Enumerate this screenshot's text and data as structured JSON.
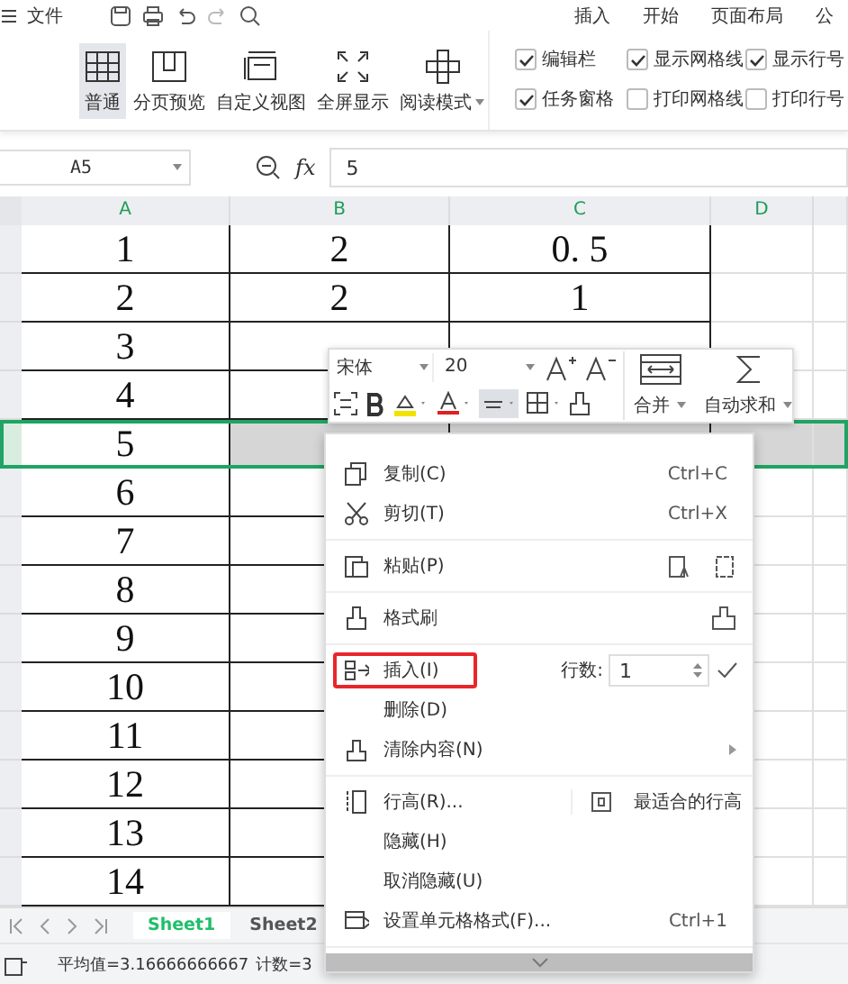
{
  "menu_bar": {
    "file_menu": "文件",
    "tabs": [
      {
        "label": "插入",
        "selected": false
      },
      {
        "label": "开始",
        "selected": false
      },
      {
        "label": "页面布局",
        "selected": false
      },
      {
        "label": "公",
        "selected": false
      }
    ]
  },
  "view_buttons": [
    {
      "label": "普通",
      "selected": true,
      "dropdown": false
    },
    {
      "label": "分页预览",
      "selected": false,
      "dropdown": false
    },
    {
      "label": "自定义视图",
      "selected": false,
      "dropdown": false
    },
    {
      "label": "全屏显示",
      "selected": false,
      "dropdown": false
    },
    {
      "label": "阅读模式",
      "selected": false,
      "dropdown": true
    }
  ],
  "view_options": [
    {
      "label": "编辑栏",
      "checked": true
    },
    {
      "label": "显示网格线",
      "checked": true
    },
    {
      "label": "显示行号",
      "checked": true
    },
    {
      "label": "任务窗格",
      "checked": true
    },
    {
      "label": "打印网格线",
      "checked": false
    },
    {
      "label": "打印行号",
      "checked": false
    }
  ],
  "formula_bar": {
    "name_box": "A5",
    "fx": "fx",
    "value": "5"
  },
  "sheet": {
    "columns": [
      "A",
      "B",
      "C",
      "D"
    ],
    "rows": [
      {
        "cells": [
          "1",
          "2",
          "0. 5"
        ],
        "selected": false
      },
      {
        "cells": [
          "2",
          "2",
          "1"
        ],
        "selected": false
      },
      {
        "cells": [
          "3"
        ],
        "selected": false
      },
      {
        "cells": [
          "4"
        ],
        "selected": false
      },
      {
        "cells": [
          "5"
        ],
        "selected": true
      },
      {
        "cells": [
          "6"
        ],
        "selected": false
      },
      {
        "cells": [
          "7"
        ],
        "selected": false
      },
      {
        "cells": [
          "8"
        ],
        "selected": false
      },
      {
        "cells": [
          "9"
        ],
        "selected": false
      },
      {
        "cells": [
          "10"
        ],
        "selected": false
      },
      {
        "cells": [
          "11"
        ],
        "selected": false
      },
      {
        "cells": [
          "12"
        ],
        "selected": false
      },
      {
        "cells": [
          "13"
        ],
        "selected": false
      },
      {
        "cells": [
          "14"
        ],
        "selected": false
      }
    ]
  },
  "mini_toolbar": {
    "font": "宋体",
    "size": "20",
    "merge": "合并",
    "autosum": "自动求和"
  },
  "context_menu": {
    "items": [
      {
        "label": "复制(C)",
        "shortcut": "Ctrl+C",
        "highlighted": false
      },
      {
        "label": "剪切(T)",
        "shortcut": "Ctrl+X",
        "highlighted": false,
        "divider_after": true
      },
      {
        "label": "粘贴(P)",
        "highlighted": false,
        "divider_after": true
      },
      {
        "label": "格式刷",
        "highlighted": false,
        "divider_after": true
      },
      {
        "label": "插入(I)",
        "highlighted": true,
        "rows_label": "行数:",
        "rows_value": "1"
      },
      {
        "label": "删除(D)",
        "highlighted": false
      },
      {
        "label": "清除内容(N)",
        "submenu": true,
        "highlighted": false,
        "divider_after": true
      },
      {
        "label": "行高(R)...",
        "side_label": "最适合的行高",
        "highlighted": false
      },
      {
        "label": "隐藏(H)",
        "highlighted": false
      },
      {
        "label": "取消隐藏(U)",
        "highlighted": false
      },
      {
        "label": "设置单元格格式(F)...",
        "shortcut": "Ctrl+1",
        "highlighted": false,
        "divider_after": true
      }
    ]
  },
  "sheet_tabs": [
    {
      "label": "Sheet1",
      "selected": true
    },
    {
      "label": "Sheet2",
      "selected": false
    }
  ],
  "status_bar": {
    "average": "平均值=3.16666666667",
    "count": "计数=3"
  }
}
